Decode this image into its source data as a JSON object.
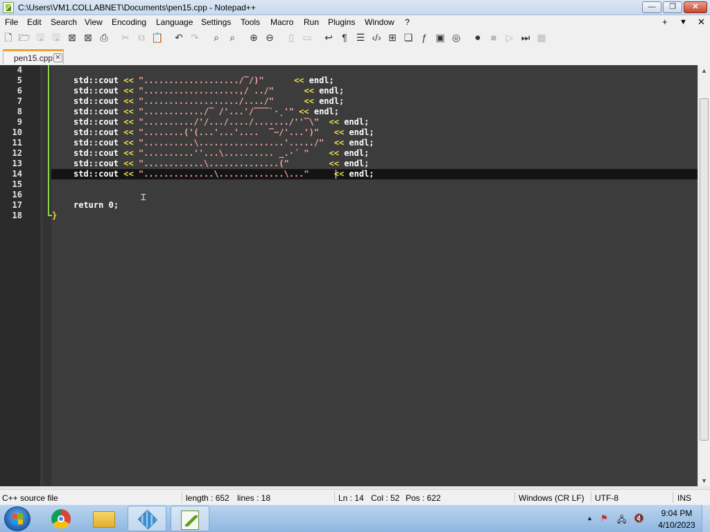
{
  "window": {
    "title": "C:\\Users\\VM1.COLLABNET\\Documents\\pen15.cpp - Notepad++",
    "minimize": "—",
    "maximize": "❐",
    "close": "✕"
  },
  "menu": {
    "items": [
      "File",
      "Edit",
      "Search",
      "View",
      "Encoding",
      "Language",
      "Settings",
      "Tools",
      "Macro",
      "Run",
      "Plugins",
      "Window",
      "?"
    ],
    "right": [
      "+",
      "▼",
      "✕"
    ]
  },
  "toolbar": {
    "icons": [
      "new-file-icon",
      "open-file-icon",
      "save-icon",
      "save-all-icon",
      "close-icon",
      "close-all-icon",
      "print-icon",
      "cut-icon",
      "copy-icon",
      "paste-icon",
      "undo-icon",
      "redo-icon",
      "find-icon",
      "replace-icon",
      "zoom-in-icon",
      "zoom-out-icon",
      "sync-vertical-icon",
      "sync-horizontal-icon",
      "word-wrap-icon",
      "show-all-chars-icon",
      "indent-guide-icon",
      "xml-tag-icon",
      "document-map-icon",
      "function-list-icon",
      "function-icon",
      "monitor-icon",
      "focus-mode-icon",
      "record-macro-icon",
      "stop-macro-icon",
      "play-macro-icon",
      "run-macro-multiple-icon",
      "save-macro-icon"
    ]
  },
  "tab": {
    "label": "pen15.cpp",
    "close": "✕"
  },
  "editor": {
    "lines": [
      {
        "n": "4",
        "kind": "empty"
      },
      {
        "n": "5",
        "kind": "cout",
        "str": "\".................../‾/)\"",
        "pad": "      "
      },
      {
        "n": "6",
        "kind": "cout",
        "str": "\"...................,/ ../\"",
        "pad": "      "
      },
      {
        "n": "7",
        "kind": "cout",
        "str": "\".................../..../\"",
        "pad": "      "
      },
      {
        "n": "8",
        "kind": "cout",
        "str": "\"............/‾ /'...'/‾‾‾`·¸'\"",
        "pad": " "
      },
      {
        "n": "9",
        "kind": "cout",
        "str": "\"........../'/.../..../......./''‾\\\"",
        "pad": "  "
      },
      {
        "n": "10",
        "kind": "cout",
        "str": "\"........('(...'...'....  ‾~/'...')\"",
        "pad": "   "
      },
      {
        "n": "11",
        "kind": "cout",
        "str": "\"..........\\.................'...../\"",
        "pad": "  "
      },
      {
        "n": "12",
        "kind": "cout",
        "str": "\"..........''...\\.......... _.·´ \"",
        "pad": "    "
      },
      {
        "n": "13",
        "kind": "cout",
        "str": "\"............\\..............(\"",
        "pad": "        "
      },
      {
        "n": "14",
        "kind": "cout",
        "str": "\"..............\\.............\\...\"",
        "pad": "     "
      },
      {
        "n": "15",
        "kind": "empty"
      },
      {
        "n": "16",
        "kind": "empty"
      },
      {
        "n": "17",
        "kind": "return"
      },
      {
        "n": "18",
        "kind": "brace"
      }
    ],
    "tokens": {
      "cout": "std::cout",
      "op": "<<",
      "endl": "endl;",
      "return": "return",
      "zero": "0;",
      "brace": "}"
    }
  },
  "status": {
    "filetype": "C++ source file",
    "length": "length : 652",
    "lines": "lines : 18",
    "ln": "Ln : 14",
    "col": "Col : 52",
    "pos": "Pos : 622",
    "eol": "Windows (CR LF)",
    "encoding": "UTF-8",
    "mode": "INS"
  },
  "taskbar": {
    "apps": [
      "chrome-icon",
      "file-explorer-icon",
      "virtualbox-icon",
      "notepadpp-icon"
    ],
    "tray": [
      "show-hidden-icons-chevron",
      "action-center-flag-icon",
      "network-icon",
      "volume-muted-icon"
    ],
    "time": "9:04 PM",
    "date": "4/10/2023"
  },
  "colors": {
    "editor_bg": "#3c3c3c",
    "current_line": "#141414",
    "operator": "#f0e04a",
    "string": "#f5a7a7",
    "fold_marker": "#8bd04a"
  }
}
